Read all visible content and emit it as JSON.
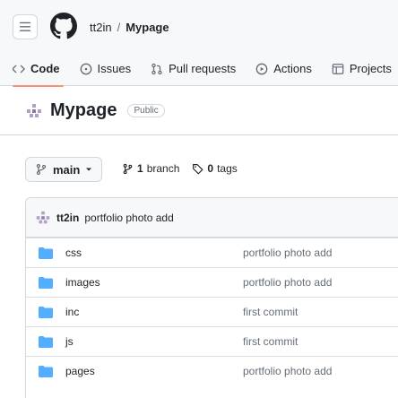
{
  "header": {
    "owner": "tt2in",
    "separator": "/",
    "repo": "Mypage"
  },
  "tabs": [
    {
      "label": "Code",
      "icon": "code-icon"
    },
    {
      "label": "Issues",
      "icon": "issue-icon"
    },
    {
      "label": "Pull requests",
      "icon": "pull-request-icon"
    },
    {
      "label": "Actions",
      "icon": "play-icon"
    },
    {
      "label": "Projects",
      "icon": "table-icon"
    }
  ],
  "repo_title": {
    "name": "Mypage",
    "visibility": "Public"
  },
  "branch": {
    "current": "main",
    "branch_count": "1",
    "branch_label": "branch",
    "tag_count": "0",
    "tag_label": "tags"
  },
  "latest_commit": {
    "author": "tt2in",
    "message": "portfolio photo add"
  },
  "files": [
    {
      "name": "css",
      "message": "portfolio photo add"
    },
    {
      "name": "images",
      "message": "portfolio photo add"
    },
    {
      "name": "inc",
      "message": "first commit"
    },
    {
      "name": "js",
      "message": "first commit"
    },
    {
      "name": "pages",
      "message": "portfolio photo add"
    }
  ],
  "colors": {
    "accent_underline": "#fd8c73",
    "folder": "#54aeff",
    "border": "#d0d7de",
    "muted": "#656d76"
  }
}
